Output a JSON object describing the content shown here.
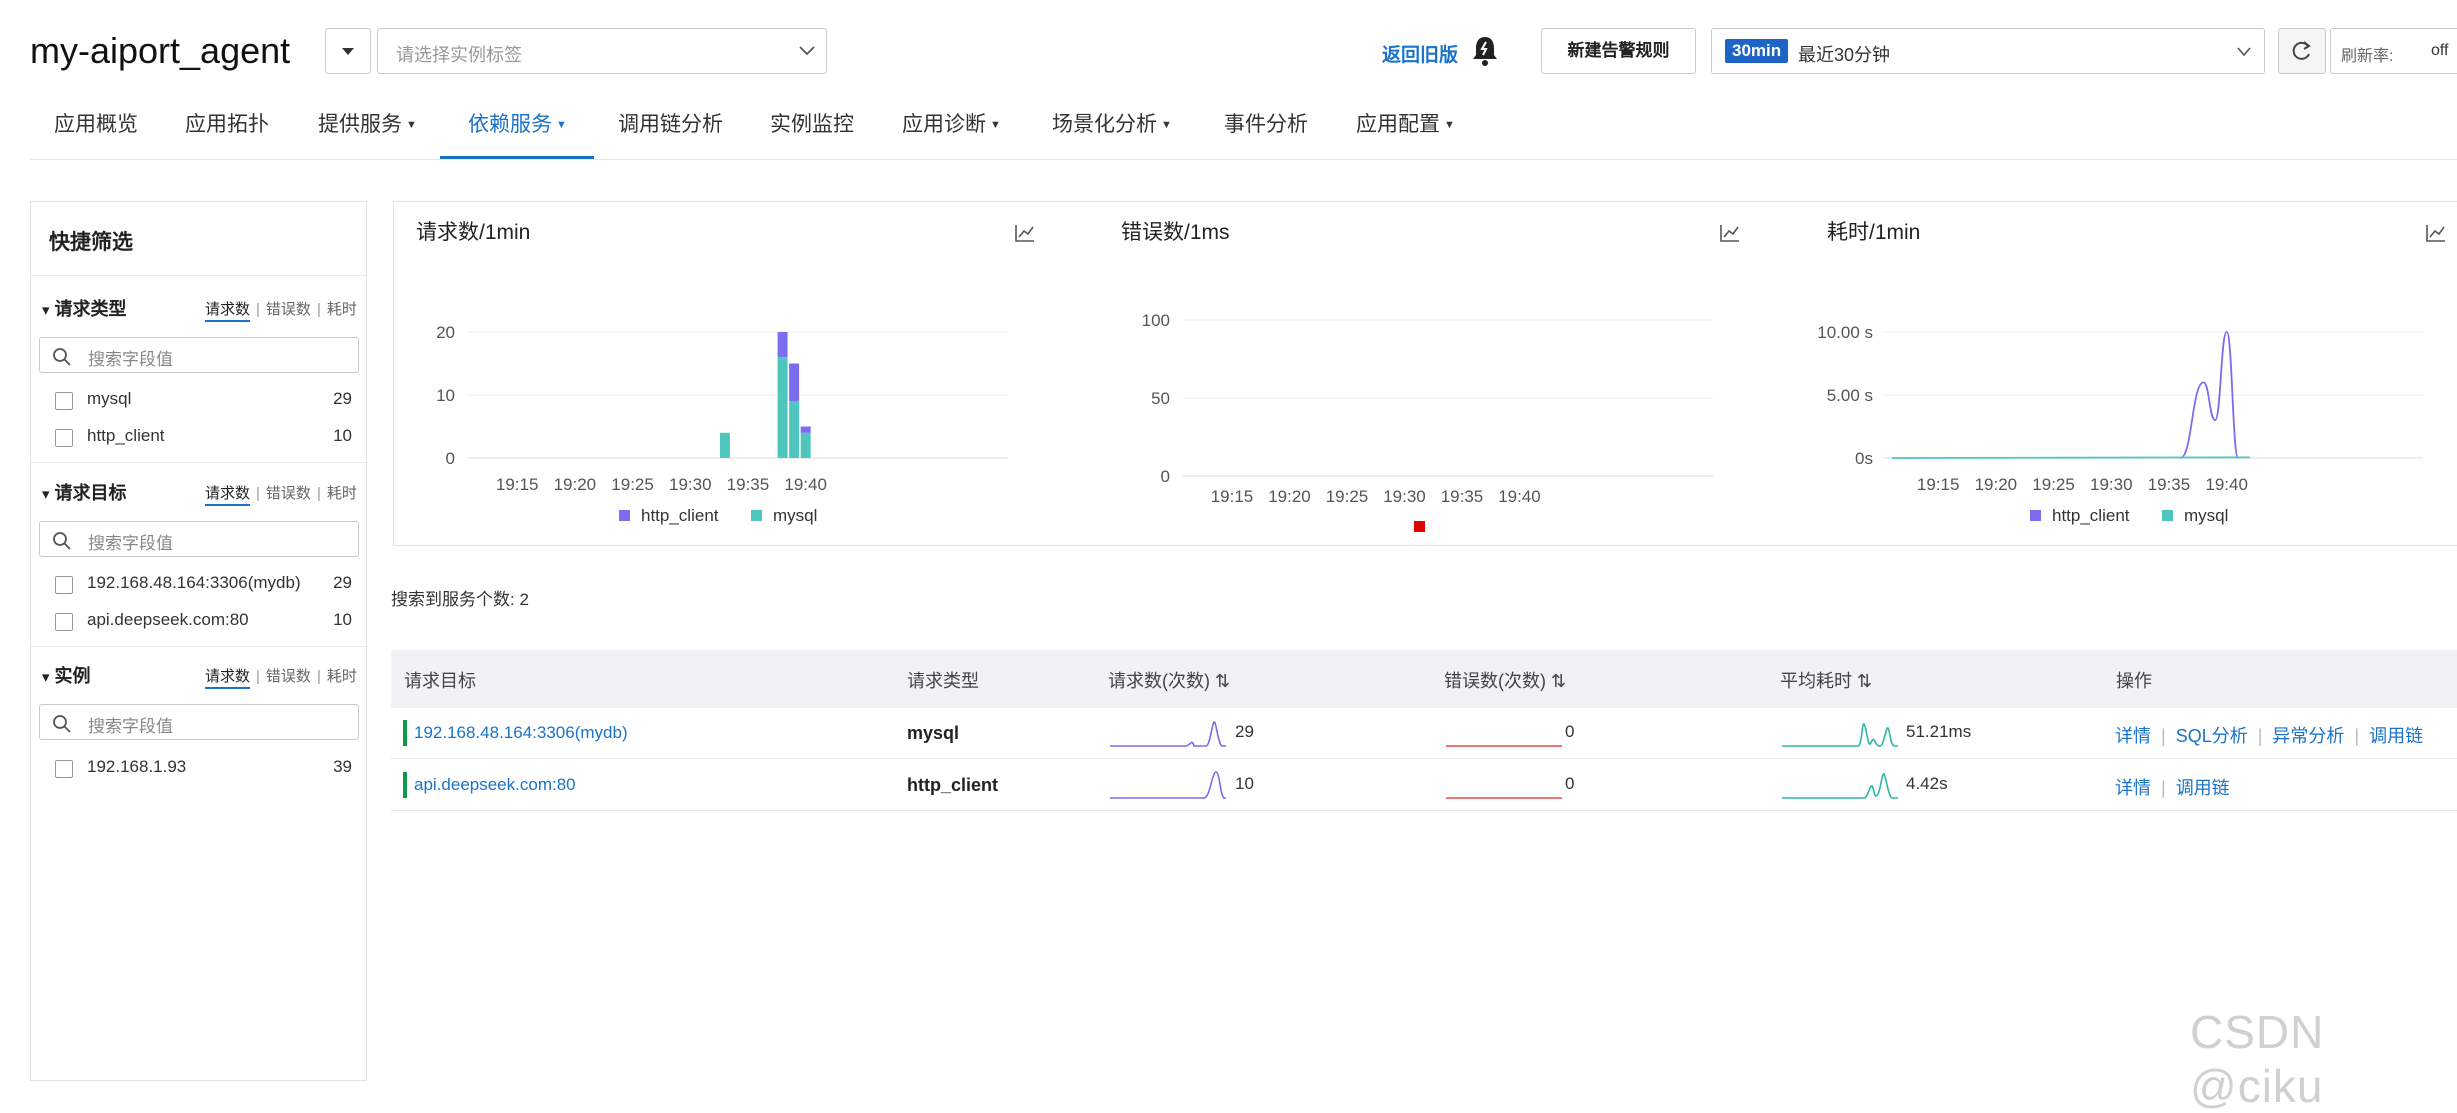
{
  "header": {
    "app_title": "my-aiport_agent",
    "instance_placeholder": "请选择实例标签",
    "back_old": "返回旧版",
    "new_alert": "新建告警规则",
    "time_badge": "30min",
    "time_text": "最近30分钟",
    "refresh_label": "刷新率:",
    "refresh_value": "off"
  },
  "nav": {
    "tabs": [
      {
        "label": "应用概览",
        "dropdown": false
      },
      {
        "label": "应用拓扑",
        "dropdown": false
      },
      {
        "label": "提供服务",
        "dropdown": true
      },
      {
        "label": "依赖服务",
        "dropdown": true,
        "active": true
      },
      {
        "label": "调用链分析",
        "dropdown": false
      },
      {
        "label": "实例监控",
        "dropdown": false
      },
      {
        "label": "应用诊断",
        "dropdown": true
      },
      {
        "label": "场景化分析",
        "dropdown": true
      },
      {
        "label": "事件分析",
        "dropdown": false
      },
      {
        "label": "应用配置",
        "dropdown": true
      }
    ]
  },
  "sidebar": {
    "title": "快捷筛选",
    "metric_tabs": [
      "请求数",
      "错误数",
      "耗时"
    ],
    "search_placeholder": "搜索字段值",
    "groups": [
      {
        "title": "请求类型",
        "items": [
          {
            "label": "mysql",
            "count": "29"
          },
          {
            "label": "http_client",
            "count": "10"
          }
        ]
      },
      {
        "title": "请求目标",
        "items": [
          {
            "label": "192.168.48.164:3306(mydb)",
            "count": "29"
          },
          {
            "label": "api.deepseek.com:80",
            "count": "10"
          }
        ]
      },
      {
        "title": "实例",
        "items": [
          {
            "label": "192.168.1.93",
            "count": "39"
          }
        ]
      }
    ]
  },
  "charts": {
    "legend": [
      "http_client",
      "mysql"
    ],
    "colors": {
      "http_client": "#7b6cf0",
      "mysql": "#4fc6bd",
      "error": "#e00000"
    }
  },
  "chart_data": [
    {
      "type": "bar",
      "title": "请求数/1min",
      "x_ticks": [
        "19:15",
        "19:20",
        "19:25",
        "19:30",
        "19:35",
        "19:40"
      ],
      "y_ticks": [
        "20",
        "10",
        "0"
      ],
      "ylim": [
        0,
        20
      ],
      "series": [
        {
          "name": "mysql",
          "points": [
            {
              "t": "19:33",
              "v": 4
            },
            {
              "t": "19:38",
              "v": 16
            },
            {
              "t": "19:39",
              "v": 9
            },
            {
              "t": "19:40",
              "v": 4
            }
          ]
        },
        {
          "name": "http_client",
          "points": [
            {
              "t": "19:38",
              "v": 4
            },
            {
              "t": "19:39",
              "v": 6
            },
            {
              "t": "19:40",
              "v": 1
            }
          ]
        }
      ]
    },
    {
      "type": "line",
      "title": "错误数/1ms",
      "x_ticks": [
        "19:15",
        "19:20",
        "19:25",
        "19:30",
        "19:35",
        "19:40"
      ],
      "y_ticks": [
        "100",
        "50",
        "0"
      ],
      "ylim": [
        0,
        100
      ],
      "series": []
    },
    {
      "type": "line",
      "title": "耗时/1min",
      "x_ticks": [
        "19:15",
        "19:20",
        "19:25",
        "19:30",
        "19:35",
        "19:40"
      ],
      "y_ticks": [
        "10.00 s",
        "5.00 s",
        "0s"
      ],
      "ylim": [
        0,
        10
      ],
      "series": [
        {
          "name": "http_client",
          "points": [
            {
              "t": "19:36",
              "v": 0
            },
            {
              "t": "19:38",
              "v": 6
            },
            {
              "t": "19:39",
              "v": 3
            },
            {
              "t": "19:40",
              "v": 10
            },
            {
              "t": "19:41",
              "v": 0
            }
          ]
        },
        {
          "name": "mysql",
          "points": [
            {
              "t": "19:11",
              "v": 0
            },
            {
              "t": "19:42",
              "v": 0.05
            }
          ]
        }
      ]
    }
  ],
  "results": {
    "found_label": "搜索到服务个数: 2",
    "columns": [
      "请求目标",
      "请求类型",
      "请求数(次数)",
      "错误数(次数)",
      "平均耗时",
      "操作"
    ],
    "rows": [
      {
        "target": "192.168.48.164:3306(mydb)",
        "type": "mysql",
        "requests": "29",
        "errors": "0",
        "latency": "51.21ms",
        "actions": [
          "详情",
          "SQL分析",
          "异常分析",
          "调用链"
        ]
      },
      {
        "target": "api.deepseek.com:80",
        "type": "http_client",
        "requests": "10",
        "errors": "0",
        "latency": "4.42s",
        "actions": [
          "详情",
          "调用链"
        ]
      }
    ]
  },
  "watermark": "CSDN @ciku"
}
